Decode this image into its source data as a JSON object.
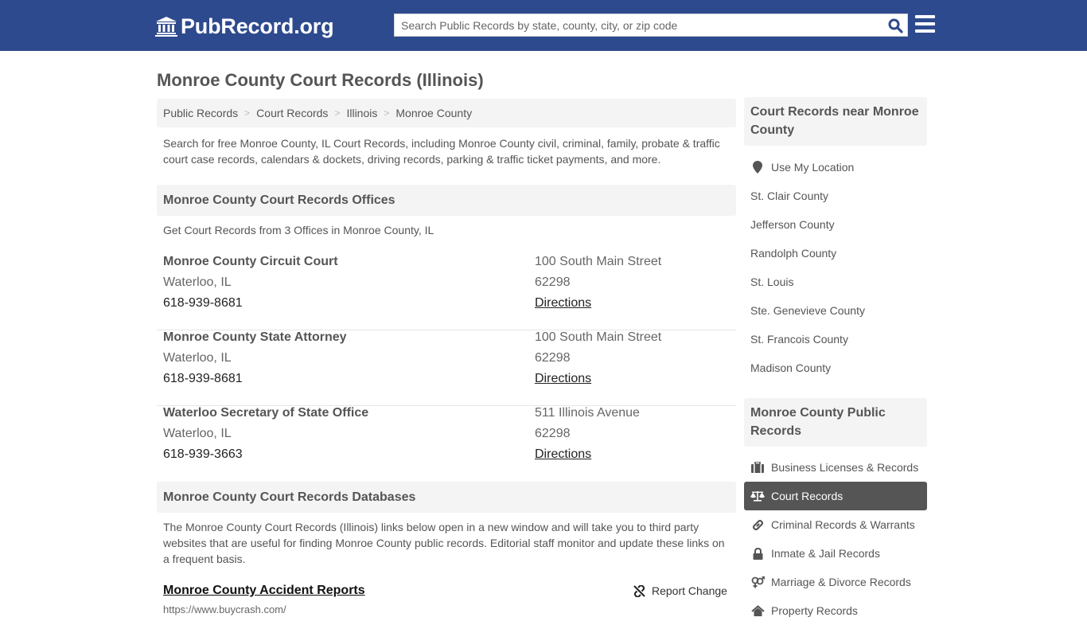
{
  "header": {
    "logo_text": "PubRecord.org",
    "logo_icon": "bank-building-icon",
    "search": {
      "placeholder": "Search Public Records by state, county, city, or zip code",
      "value": "",
      "button_icon": "search-icon"
    },
    "menu_icon": "hamburger-menu-icon",
    "brand_color": "#2e4a8e"
  },
  "page": {
    "title": "Monroe County Court Records (Illinois)",
    "breadcrumb": [
      {
        "label": "Public Records"
      },
      {
        "label": "Court Records"
      },
      {
        "label": "Illinois"
      },
      {
        "label": "Monroe County"
      }
    ],
    "breadcrumb_separator": ">",
    "intro": "Search for free Monroe County, IL Court Records, including Monroe County civil, criminal, family, probate & traffic court case records, calendars & dockets, driving records, parking & traffic ticket payments, and more."
  },
  "offices": {
    "heading": "Monroe County Court Records Offices",
    "subheading": "Get Court Records from 3 Offices in Monroe County, IL",
    "items": [
      {
        "name": "Monroe County Circuit Court",
        "city": "Waterloo, IL",
        "phone": "618-939-8681",
        "address": "100 South Main Street",
        "zip": "62298",
        "directions_label": "Directions"
      },
      {
        "name": "Monroe County State Attorney",
        "city": "Waterloo, IL",
        "phone": "618-939-8681",
        "address": "100 South Main Street",
        "zip": "62298",
        "directions_label": "Directions"
      },
      {
        "name": "Waterloo Secretary of State Office",
        "city": "Waterloo, IL",
        "phone": "618-939-3663",
        "address": "511 Illinois Avenue",
        "zip": "62298",
        "directions_label": "Directions"
      }
    ]
  },
  "databases": {
    "heading": "Monroe County Court Records Databases",
    "description": "The Monroe County Court Records (Illinois) links below open in a new window and will take you to third party websites that are useful for finding Monroe County public records. Editorial staff monitor and update these links on a frequent basis.",
    "items": [
      {
        "title": "Monroe County Accident Reports",
        "url": "https://www.buycrash.com/",
        "report_label": "Report Change",
        "report_icon": "broken-link-icon"
      }
    ]
  },
  "sidebar": {
    "nearby": {
      "heading": "Court Records near Monroe County",
      "use_location_label": "Use My Location",
      "use_location_icon": "map-marker-icon",
      "items": [
        "St. Clair County",
        "Jefferson County",
        "Randolph County",
        "St. Louis",
        "Ste. Genevieve County",
        "St. Francois County",
        "Madison County"
      ]
    },
    "public_records": {
      "heading": "Monroe County Public Records",
      "items": [
        {
          "label": "Business Licenses & Records",
          "icon": "briefcase-icon",
          "active": false
        },
        {
          "label": "Court Records",
          "icon": "balance-scale-icon",
          "active": true
        },
        {
          "label": "Criminal Records & Warrants",
          "icon": "link-icon",
          "active": false
        },
        {
          "label": "Inmate & Jail Records",
          "icon": "lock-icon",
          "active": false
        },
        {
          "label": "Marriage & Divorce Records",
          "icon": "gender-icon",
          "active": false
        },
        {
          "label": "Property Records",
          "icon": "home-icon",
          "active": false
        }
      ]
    }
  }
}
